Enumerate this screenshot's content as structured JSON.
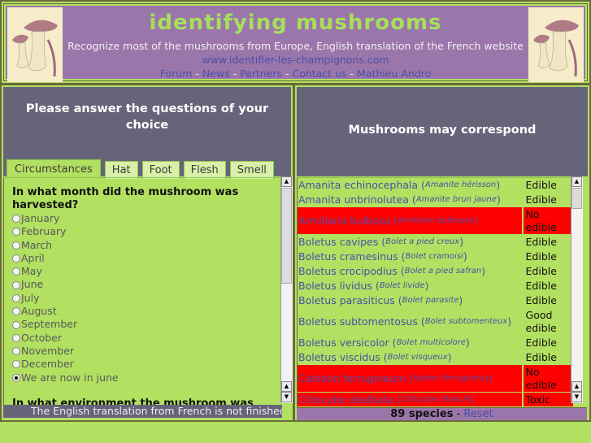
{
  "header": {
    "title": "identifying mushrooms",
    "tagline": "Recognize most of the mushrooms from Europe, English translation of the French website",
    "url": "www.identifier-les-champignons.com",
    "nav": [
      "Forum",
      "News",
      "Partners",
      "Contact us",
      "Mathieu Andro"
    ],
    "nav_separator": " - ",
    "image_icon": "mushroom-illustration"
  },
  "left_panel": {
    "heading": "Please answer the questions of your choice",
    "tabs": [
      {
        "label": "Circumstances",
        "active": true
      },
      {
        "label": "Hat",
        "active": false
      },
      {
        "label": "Foot",
        "active": false
      },
      {
        "label": "Flesh",
        "active": false
      },
      {
        "label": "Smell",
        "active": false
      }
    ],
    "question1": {
      "title": "In what month did the mushroom was harvested?",
      "options": [
        "January",
        "February",
        "March",
        "April",
        "May",
        "June",
        "July",
        "August",
        "September",
        "October",
        "November",
        "December",
        "We are now in june"
      ],
      "selected": "We are now in june"
    },
    "question2": {
      "title": "In what environment the mushroom was"
    },
    "notice": "The English translation from French is not finished and"
  },
  "right_panel": {
    "heading": "Mushrooms may correspond",
    "results": [
      {
        "latin": "Amanita echinocephala",
        "french": "Amanite hérisson",
        "edibility": "Edible",
        "warning": false
      },
      {
        "latin": "Amanita unbrinolutea",
        "french": "Amanite brun jaune",
        "edibility": "Edible",
        "warning": false
      },
      {
        "latin": "Armillaria bulbosa",
        "french": "Armilaire bulbeuse",
        "edibility": "No edible",
        "warning": true
      },
      {
        "latin": "Boletus cavipes",
        "french": "Bolet a pied creux",
        "edibility": "Edible",
        "warning": false
      },
      {
        "latin": "Boletus cramesinus",
        "french": "Bolet cramoisi",
        "edibility": "Edible",
        "warning": false
      },
      {
        "latin": "Boletus crocipodius",
        "french": "Bolet a pied safran",
        "edibility": "Edible",
        "warning": false
      },
      {
        "latin": "Boletus lividus",
        "french": "Bolet livide",
        "edibility": "Edible",
        "warning": false
      },
      {
        "latin": "Boletus parasiticus",
        "french": "Bolet parasite",
        "edibility": "Edible",
        "warning": false
      },
      {
        "latin": "Boletus subtomentosus",
        "french": "Bolet subtomenteux",
        "edibility": "Good edible",
        "warning": false
      },
      {
        "latin": "Boletus versicolor",
        "french": "Bolet multicolore",
        "edibility": "Edible",
        "warning": false
      },
      {
        "latin": "Boletus viscidus",
        "french": "Bolet visqueux",
        "edibility": "Edible",
        "warning": false
      },
      {
        "latin": "Calodon ferrugineum",
        "french": "Hydne ferrugineux",
        "edibility": "No edible",
        "warning": true
      },
      {
        "latin": "Clitocybe dealbata",
        "french": "Clitocybe blanchi",
        "edibility": "Toxic",
        "warning": true
      }
    ],
    "species_count": "89 species",
    "reset_label": "Reset"
  },
  "colors": {
    "page_bg": "#b2e061",
    "header_bg": "#9b76aa",
    "panel_head_bg": "#67647a",
    "title_green": "#a6e05a",
    "link_blue": "#4a4fa8",
    "warning_red": "#ff0000"
  }
}
